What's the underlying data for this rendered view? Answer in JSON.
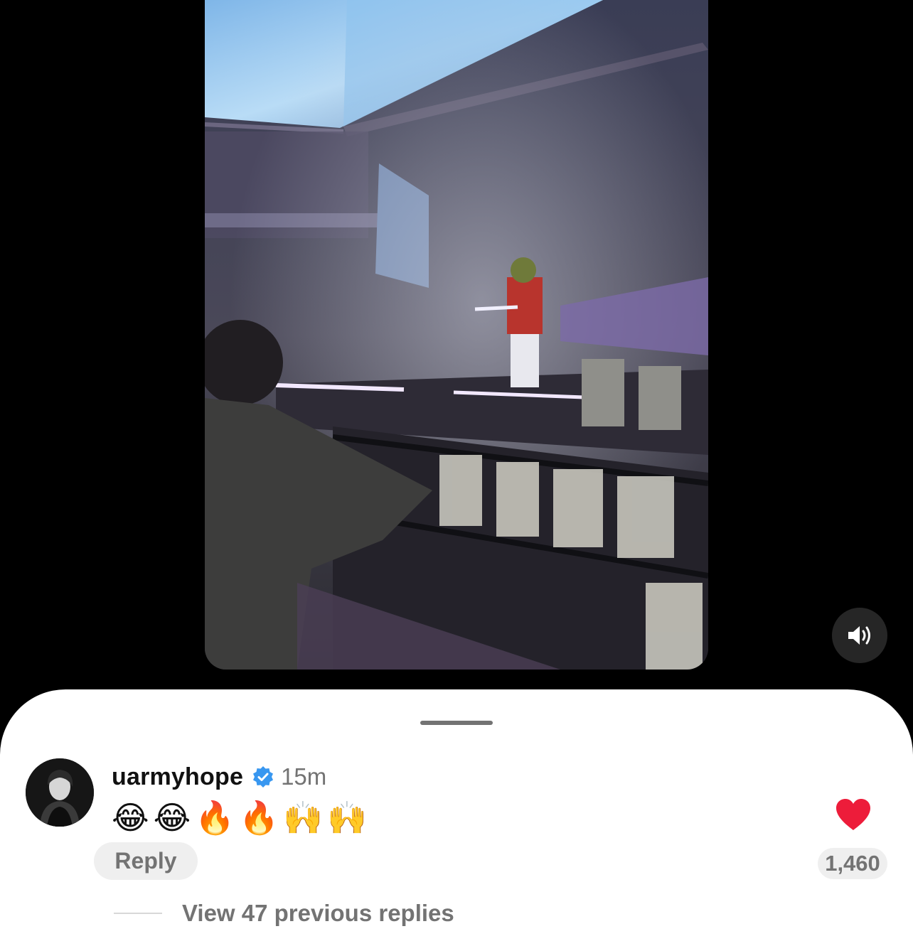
{
  "video": {
    "mute_icon": "speaker-wave-icon"
  },
  "comment": {
    "username": "uarmyhope",
    "verified_icon": "verified-badge-icon",
    "time_ago": "15m",
    "text": "😂😂🔥🔥🙌🙌",
    "reply_label": "Reply",
    "like_icon": "heart-filled-icon",
    "like_color": "#ed1c3a",
    "like_count": "1,460",
    "view_replies_label": "View 47 previous replies"
  },
  "colors": {
    "verified_blue": "#3897f0",
    "secondary_text": "#737373",
    "pill_background": "#efefef"
  }
}
